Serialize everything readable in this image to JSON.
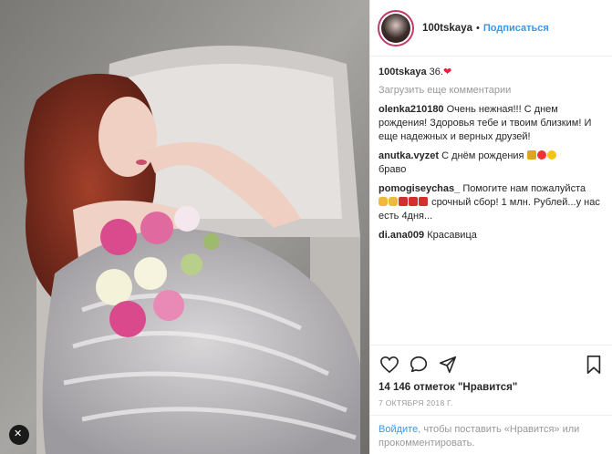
{
  "post": {
    "username": "100tskaya",
    "follow_label": "Подписаться",
    "dot": "•",
    "caption_text": "36.",
    "caption_emoji": "❤",
    "load_more": "Загрузить еще комментарии",
    "comments": [
      {
        "user": "olenka210180",
        "text": "Очень нежная!!! С днем рождения! Здоровья тебе и твоим близким! И еще надежных и верных друзей!"
      },
      {
        "user": "anutka.vyzet",
        "text": "С днём рождения",
        "text2": "браво"
      },
      {
        "user": "pomogiseychas_",
        "text": "Помогите нам пожалуйста",
        "text2": "срочный сбор! 1 млн. Рублей...у нас есть 4дня..."
      },
      {
        "user": "di.ana009",
        "text": "Красавица"
      }
    ],
    "likes": "14 146 отметок \"Нравится\"",
    "date": "7 ОКТЯБРЯ 2018 Г.",
    "login_link": "Войдите",
    "login_text": ", чтобы поставить «Нравится» или прокомментировать."
  },
  "icons": {
    "like": "heart-icon",
    "comment": "comment-icon",
    "share": "share-icon",
    "save": "bookmark-icon"
  },
  "colors": {
    "link": "#3897f0",
    "avatar_ring": "#c23a6b",
    "heart": "#ed1c3a"
  }
}
